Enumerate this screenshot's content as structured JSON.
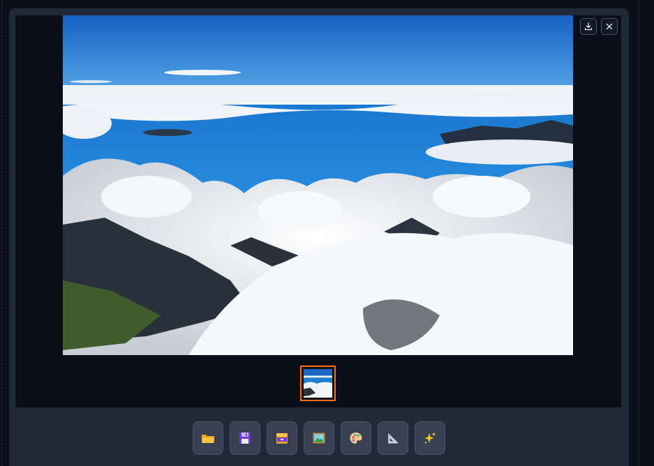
{
  "viewer": {
    "image": {
      "alt": "",
      "palette": {
        "sky_top": "#1565c0",
        "sky_bottom": "#4aa3e8",
        "sea": "#1e7fd1",
        "cloud": "#f2f4f7",
        "mountain": "#2c3440",
        "grass": "#3d5a2a"
      }
    },
    "actions": [
      {
        "name": "download",
        "icon": "download-icon"
      },
      {
        "name": "close",
        "icon": "close-icon"
      }
    ],
    "thumbnails": [
      {
        "selected": true
      }
    ]
  },
  "toolbar": {
    "buttons": [
      {
        "name": "open-folder",
        "icon": "folder-icon",
        "color": "#f5b82e"
      },
      {
        "name": "save",
        "icon": "floppy-disk-icon",
        "color": "#7c3aed"
      },
      {
        "name": "archive",
        "icon": "card-file-box-icon",
        "color": "#f5b82e"
      },
      {
        "name": "send-to-image",
        "icon": "framed-picture-icon",
        "color": "#22c55e"
      },
      {
        "name": "send-to-inpaint",
        "icon": "artist-palette-icon",
        "color": "#f4c98c"
      },
      {
        "name": "send-to-extras",
        "icon": "triangular-ruler-icon",
        "color": "#94a3b8"
      },
      {
        "name": "enhance",
        "icon": "sparkles-icon",
        "color": "#facc15"
      }
    ]
  },
  "colors": {
    "accent": "#f97316",
    "panel": "#1f2937",
    "background": "#0b0f19",
    "button": "#374151"
  }
}
